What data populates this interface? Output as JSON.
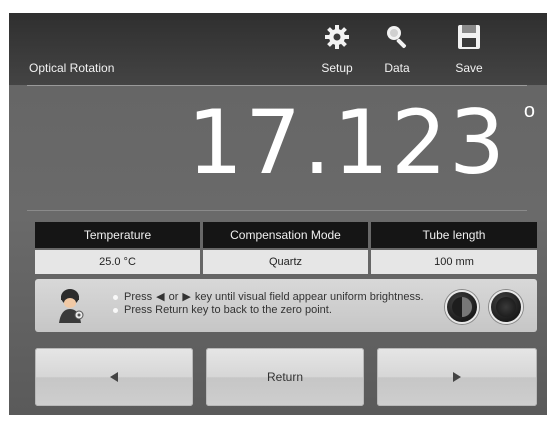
{
  "header": {
    "title": "Optical Rotation",
    "tools": [
      {
        "label": "Setup",
        "icon": "gear-icon"
      },
      {
        "label": "Data",
        "icon": "magnifier-icon"
      },
      {
        "label": "Save",
        "icon": "floppy-disk-icon"
      }
    ]
  },
  "reading": {
    "value": "17.123",
    "unit": "o"
  },
  "info": [
    {
      "label": "Temperature",
      "value": "25.0 °C"
    },
    {
      "label": "Compensation Mode",
      "value": "Quartz"
    },
    {
      "label": "Tube length",
      "value": "100 mm"
    }
  ],
  "help": {
    "icon": "operator-icon",
    "line1_prefix": "Press",
    "line1_or": "or",
    "line1_suffix": "key until visual field appear uniform brightness.",
    "line2": "Press Return key to back to the zero point."
  },
  "buttons": {
    "left_icon": "left-arrow-icon",
    "return_label": "Return",
    "right_icon": "right-arrow-icon"
  },
  "colors": {
    "topbar": "#333333",
    "screen": "#666666",
    "header_cell": "#151515",
    "value_cell": "#e6e6e6"
  }
}
